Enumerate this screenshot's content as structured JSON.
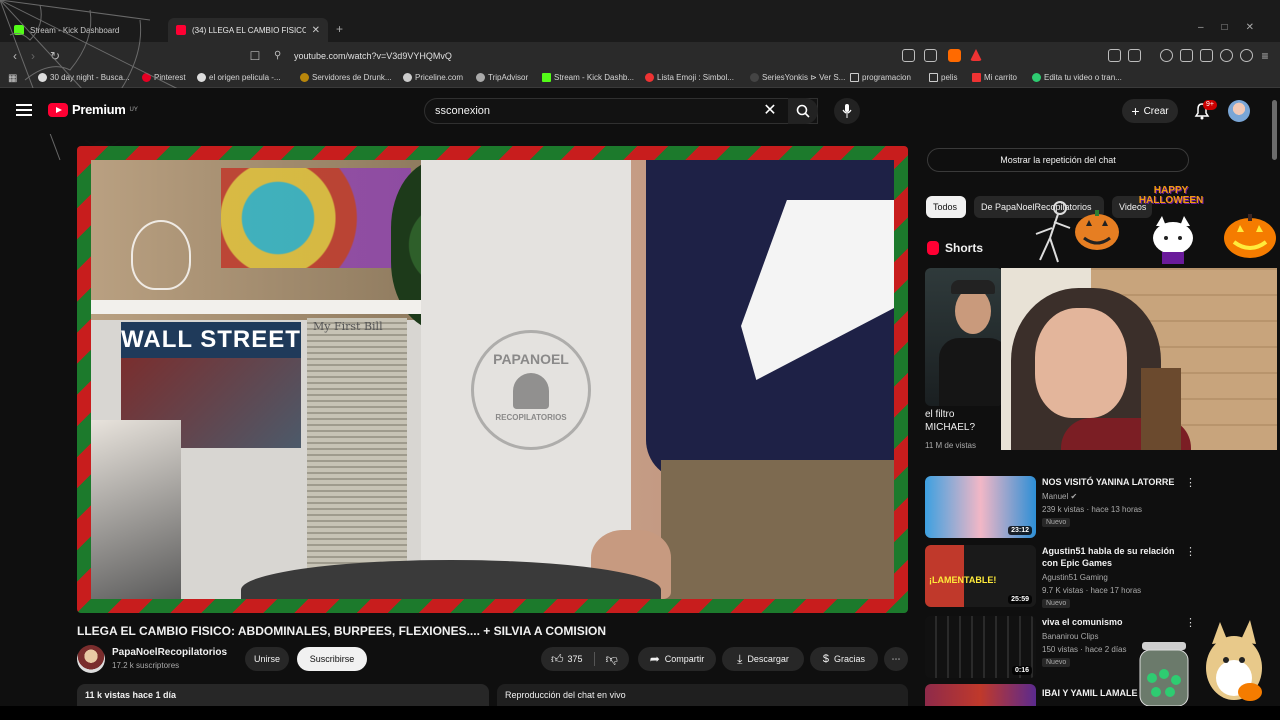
{
  "browser": {
    "tabs": [
      {
        "label": "Stream - Kick Dashboard",
        "active": false
      },
      {
        "label": "(34) LLEGA EL CAMBIO FISICO",
        "active": true
      }
    ],
    "new_tab_glyph": "+",
    "url": "youtube.com/watch?v=V3d9VYHQMvQ",
    "bookmarks": [
      "30 day night - Busca...",
      "Pinterest",
      "el origen pelicula -...",
      "Servidores de Drunk...",
      "Priceline.com",
      "TripAdvisor",
      "Stream - Kick Dashb...",
      "Lista Emoji : Simbol...",
      "SeriesYonkis ⊳ Ver S...",
      "programacion",
      "pelis",
      "Mi carrito",
      "Edita tu video o tran..."
    ]
  },
  "header": {
    "logo_text": "Premium",
    "logo_sup": "UY",
    "search_value": "ssconexion",
    "create_label": "Crear",
    "notifications_badge": "9+"
  },
  "video": {
    "title": "LLEGA EL CAMBIO FISICO: ABDOMINALES, BURPEES, FLEXIONES.... + SILVIA A COMISION",
    "channel": "PapaNoelRecopilatorios",
    "subscribers": "17.2 k suscriptores",
    "join_label": "Unirse",
    "subscribe_label": "Suscribirse",
    "likes": "375",
    "share_label": "Compartir",
    "download_label": "Descargar",
    "thanks_label": "Gracias",
    "views_info": "11 k vistas  hace 1 día",
    "chat_replay_header": "Reproducción del chat en vivo",
    "overlay": {
      "sign_text": "WALL STREET",
      "sign2_text": "My First Bill",
      "watermark_line1": "PAPANOEL",
      "watermark_line2": "RECOPILATORIOS"
    }
  },
  "sidebar": {
    "chat_replay_button": "Mostrar la repetición del chat",
    "chips": [
      "Todos",
      "De PapaNoelRecopilatorios",
      "Videos"
    ],
    "shorts_label": "Shorts",
    "short": {
      "title": "el filtro MICHAEL?",
      "views": "11 M de vistas"
    },
    "halloween_text": "HAPPY HALLOWEEN",
    "recommendations": [
      {
        "title": "NOS VISITÓ YANINA LATORRE",
        "channel": "Manuel",
        "meta": "239 k vistas · hace 13 horas",
        "badge": "Nuevo",
        "duration": "23:12"
      },
      {
        "title": "Agustin51 habla de su relación con Epic Games",
        "channel": "Agustin51 Gaming",
        "meta": "9.7 K vistas · hace 17 horas",
        "badge": "Nuevo",
        "duration": "25:59",
        "thumb_text": "¡LAMENTABLE!"
      },
      {
        "title": "viva el comunismo",
        "channel": "Bananirou Clips",
        "meta": "150 vistas · hace 2 días",
        "badge": "Nuevo",
        "duration": "0:16"
      },
      {
        "title": "IBAI Y YAMIL LAMALE",
        "channel": "",
        "meta": "",
        "badge": "",
        "duration": ""
      }
    ]
  },
  "colors": {
    "yt_red": "#ff0033",
    "background": "#0f0f0f",
    "chip_active": "#f1f1f1",
    "border_red": "#c81d1d",
    "border_green": "#1c7a2c"
  }
}
